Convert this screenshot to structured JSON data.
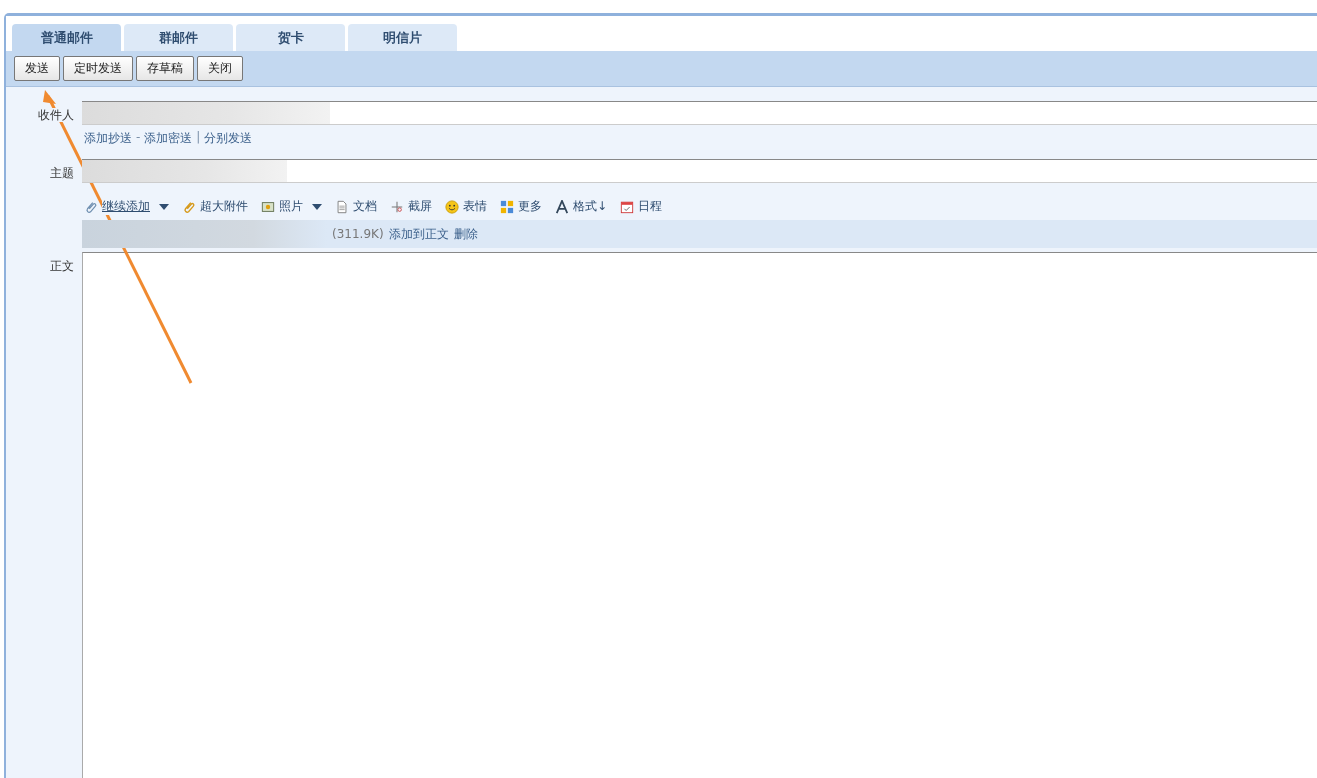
{
  "tabs": [
    {
      "label": "普通邮件",
      "selected": true
    },
    {
      "label": "群邮件",
      "selected": false
    },
    {
      "label": "贺卡",
      "selected": false
    },
    {
      "label": "明信片",
      "selected": false
    }
  ],
  "toolbar": {
    "buttons": [
      "发送",
      "定时发送",
      "存草稿",
      "关闭"
    ]
  },
  "recipient": {
    "label": "收件人",
    "links": [
      {
        "kind": "link",
        "text": "添加抄送"
      },
      {
        "kind": "sep",
        "text": "-"
      },
      {
        "kind": "link",
        "text": "添加密送"
      },
      {
        "kind": "sep",
        "text": "|"
      },
      {
        "kind": "link",
        "text": "分别发送"
      }
    ]
  },
  "subject": {
    "label": "主题"
  },
  "attach_tools": [
    {
      "kind": "clip",
      "label": "继续添加",
      "underlined": true,
      "dropdown": true
    },
    {
      "kind": "bigclip",
      "label": "超大附件",
      "underlined": false,
      "dropdown": false
    },
    {
      "kind": "photo",
      "label": "照片",
      "underlined": false,
      "dropdown": true
    },
    {
      "kind": "doc",
      "label": "文档",
      "underlined": false,
      "dropdown": false
    },
    {
      "kind": "screenshot",
      "label": "截屏",
      "underlined": false,
      "dropdown": false
    },
    {
      "kind": "smiley",
      "label": "表情",
      "underlined": false,
      "dropdown": false
    },
    {
      "kind": "grid",
      "label": "更多",
      "underlined": false,
      "dropdown": false
    },
    {
      "kind": "font",
      "label": "格式↓",
      "underlined": false,
      "dropdown": false
    },
    {
      "kind": "calendar",
      "label": "日程",
      "underlined": false,
      "dropdown": false
    }
  ],
  "attachment": {
    "size": "(311.9K)",
    "actions": [
      "添加到正文",
      "删除"
    ]
  },
  "body": {
    "label": "正文"
  }
}
